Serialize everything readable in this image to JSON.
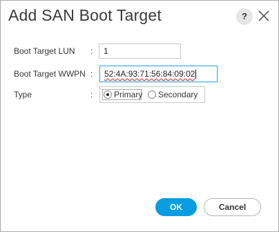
{
  "dialog": {
    "title": "Add SAN Boot Target",
    "help_label": "?",
    "close_icon": "close-icon"
  },
  "form": {
    "lun": {
      "label": "Boot Target LUN",
      "colon": ":",
      "value": "1"
    },
    "wwpn": {
      "label": "Boot Target WWPN",
      "colon": ":",
      "value": "52:4A:93:71:56:84:09:02"
    },
    "type": {
      "label": "Type",
      "colon": ":",
      "options": [
        {
          "label": "Primary",
          "selected": true
        },
        {
          "label": "Secondary",
          "selected": false
        }
      ]
    }
  },
  "buttons": {
    "ok_label": "OK",
    "cancel_label": "Cancel"
  },
  "colors": {
    "ok_button": "#0a9ce0",
    "focus_border": "#3fa9e0"
  }
}
